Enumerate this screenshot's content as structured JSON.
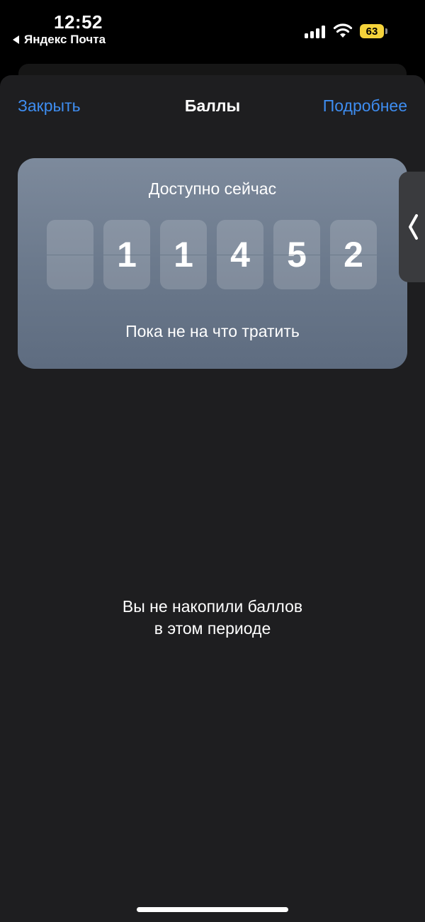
{
  "status_bar": {
    "time": "12:52",
    "back_app": "Яндекс Почта",
    "battery": "63",
    "icons": [
      "back-arrow-icon",
      "signal-icon",
      "wifi-icon",
      "battery-icon"
    ]
  },
  "nav": {
    "close": "Закрыть",
    "title": "Баллы",
    "more": "Подробнее"
  },
  "card": {
    "label": "Доступно сейчас",
    "digits": [
      "",
      "1",
      "1",
      "4",
      "5",
      "2"
    ],
    "note": "Пока не на что тратить"
  },
  "side_handle": {
    "icon": "chevron-left-icon"
  },
  "empty_state": {
    "line1": "Вы не накопили баллов",
    "line2": "в этом периоде"
  },
  "colors": {
    "accent": "#3e8df0",
    "background": "#1e1e20",
    "card": "#6a788b",
    "battery": "#f5d33a"
  }
}
